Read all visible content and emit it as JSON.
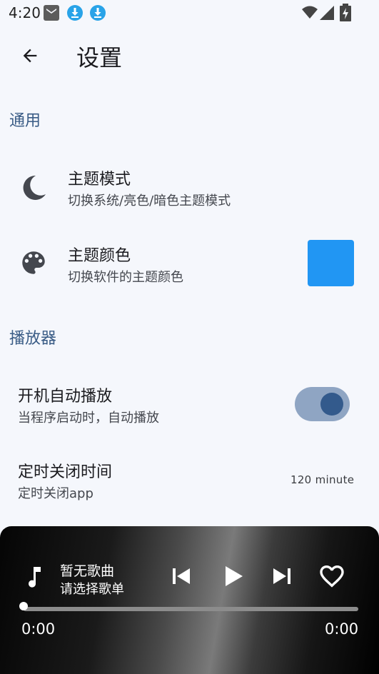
{
  "status_bar": {
    "time": "4:20",
    "icons": [
      "mail-icon",
      "download-icon",
      "download-icon",
      "wifi-icon",
      "signal-icon",
      "battery-charging-icon"
    ]
  },
  "app_bar": {
    "back_icon": "arrow-back-icon",
    "title": "设置"
  },
  "sections": {
    "general": {
      "header": "通用",
      "theme_mode": {
        "icon": "moon-icon",
        "title": "主题模式",
        "subtitle": "切换系统/亮色/暗色主题模式"
      },
      "theme_color": {
        "icon": "palette-icon",
        "title": "主题颜色",
        "subtitle": "切换软件的主题颜色",
        "swatch_color": "#2196f3"
      }
    },
    "player": {
      "header": "播放器",
      "autoplay": {
        "title": "开机自动播放",
        "subtitle": "当程序启动时，自动播放",
        "enabled": true
      },
      "sleep_timer": {
        "title": "定时关闭时间",
        "subtitle": "定时关闭app",
        "value": "120 minute"
      }
    }
  },
  "mini_player": {
    "icon": "music-note-icon",
    "song_title": "暂无歌曲",
    "song_subtitle": "请选择歌单",
    "controls": [
      "skip-previous-icon",
      "play-icon",
      "skip-next-icon",
      "heart-outline-icon"
    ],
    "progress": 0,
    "current_time": "0:00",
    "total_time": "0:00"
  },
  "colors": {
    "accent": "#3a5c86",
    "swatch": "#2196f3",
    "toggle_track": "#8fa5c3",
    "toggle_knob": "#335a8c",
    "background": "#f5f7fc"
  }
}
